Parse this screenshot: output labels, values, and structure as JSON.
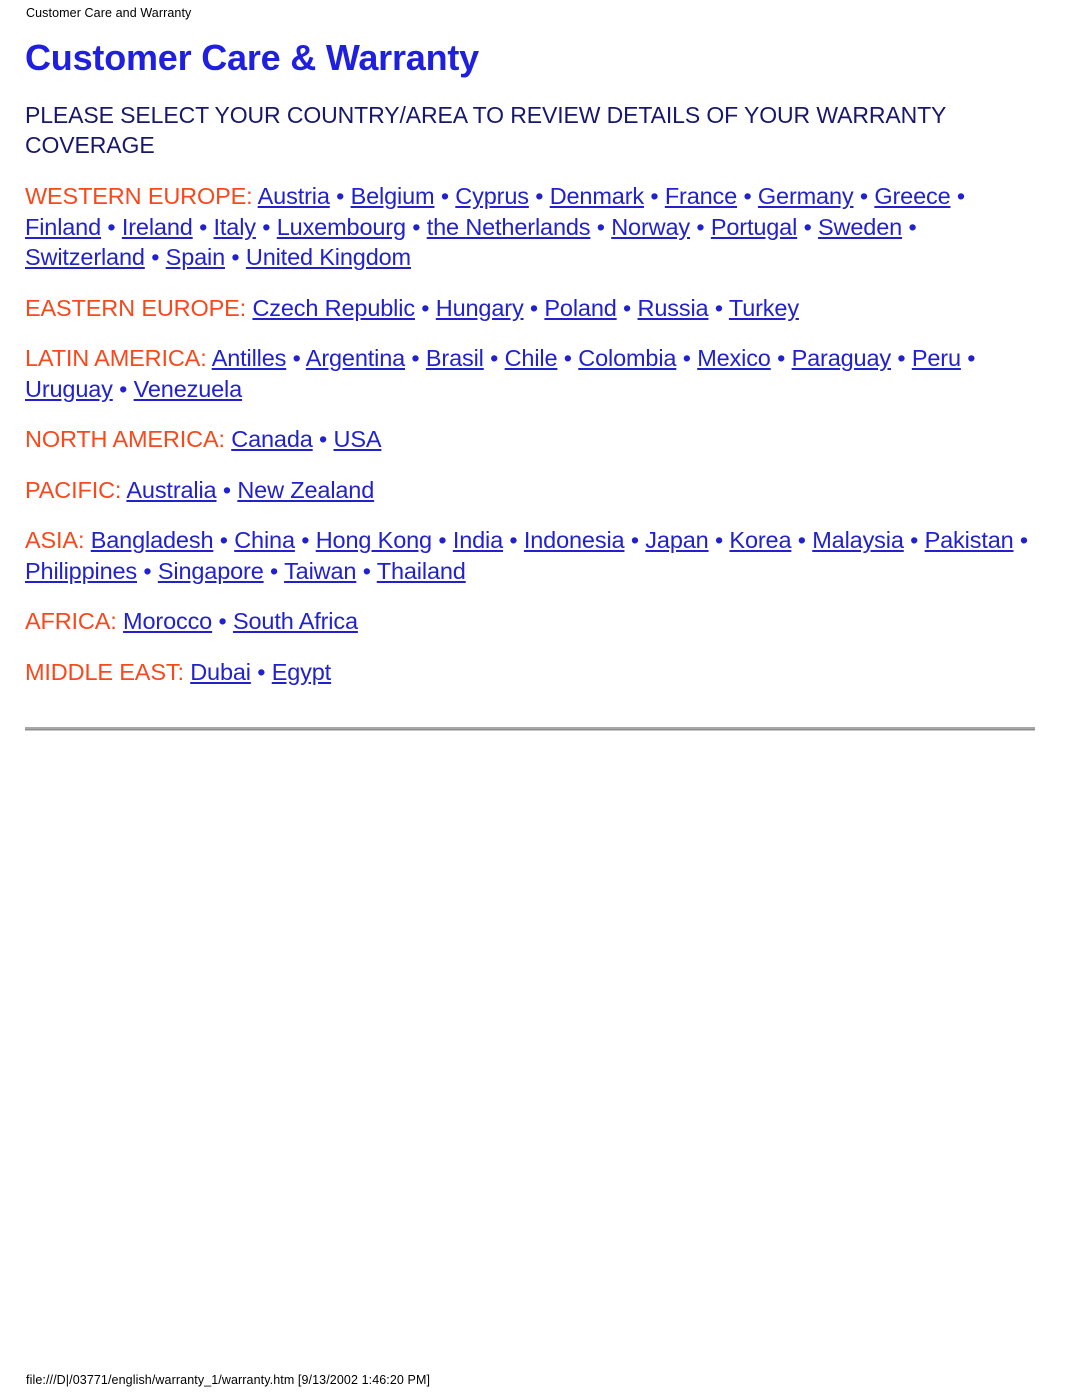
{
  "header": {
    "running_title": "Customer Care and Warranty"
  },
  "title": "Customer Care & Warranty",
  "intro": "PLEASE SELECT YOUR COUNTRY/AREA TO REVIEW DETAILS OF YOUR WARRANTY COVERAGE",
  "separator": "•",
  "colors": {
    "title_blue": "#1f1fe0",
    "heading_navy": "#18186a",
    "region_orange": "#f8491c",
    "link_blue": "#2222cc",
    "rule_gray": "#8d8d8d",
    "page_background": "#ffffff"
  },
  "regions": [
    {
      "label": "WESTERN EUROPE:",
      "countries": [
        "Austria",
        "Belgium",
        "Cyprus",
        "Denmark",
        "France",
        "Germany",
        "Greece",
        "Finland",
        "Ireland",
        "Italy",
        "Luxembourg",
        "the Netherlands",
        "Norway",
        "Portugal",
        "Sweden",
        "Switzerland",
        "Spain",
        "United Kingdom"
      ]
    },
    {
      "label": "EASTERN EUROPE:",
      "countries": [
        "Czech Republic",
        "Hungary",
        "Poland",
        "Russia",
        "Turkey"
      ]
    },
    {
      "label": "LATIN AMERICA:",
      "countries": [
        "Antilles",
        "Argentina",
        "Brasil",
        "Chile",
        "Colombia",
        "Mexico",
        "Paraguay",
        "Peru",
        "Uruguay",
        "Venezuela"
      ]
    },
    {
      "label": "NORTH AMERICA:",
      "countries": [
        "Canada",
        "USA"
      ]
    },
    {
      "label": "PACIFIC:",
      "countries": [
        "Australia",
        "New Zealand"
      ]
    },
    {
      "label": "ASIA:",
      "countries": [
        "Bangladesh",
        "China",
        "Hong Kong",
        "India",
        "Indonesia",
        "Japan",
        "Korea",
        "Malaysia",
        "Pakistan",
        "Philippines",
        "Singapore",
        "Taiwan",
        "Thailand"
      ]
    },
    {
      "label": "AFRICA:",
      "countries": [
        "Morocco",
        "South Africa"
      ]
    },
    {
      "label": "MIDDLE EAST:",
      "countries": [
        "Dubai",
        "Egypt"
      ]
    }
  ],
  "footer": {
    "path": "file:///D|/03771/english/warranty_1/warranty.htm [9/13/2002 1:46:20 PM]"
  }
}
